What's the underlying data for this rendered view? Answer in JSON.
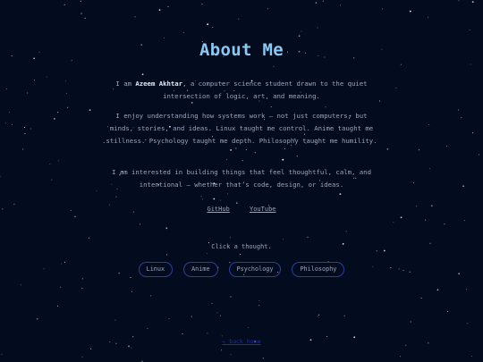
{
  "page": {
    "title": "About Me",
    "intro_prefix": "I am ",
    "intro_name": "Azeem Akhtar",
    "intro_suffix": ", a computer science student drawn to the quiet intersection of logic, art, and meaning.",
    "paragraph_2": "I enjoy understanding how systems work — not just computers, but minds, stories, and ideas. Linux taught me control. Anime taught me stillness. Psychology taught me depth. Philosophy taught me humility.",
    "paragraph_3": "I am interested in building things that feel thoughtful, calm, and intentional — whether that’s code, design, or ideas."
  },
  "links": {
    "github": "GitHub",
    "youtube": "YouTube"
  },
  "thoughts": {
    "prompt": "Click a thought.",
    "chips": [
      "Linux",
      "Anime",
      "Psychology",
      "Philosophy"
    ]
  },
  "footer": {
    "link_label": "← back home"
  },
  "colors": {
    "background": "#030b1f",
    "title": "#8cc8f2",
    "text": "#9aa6bd",
    "chip_border": "#2c3f9a",
    "footer_link": "#1e2fa8"
  }
}
